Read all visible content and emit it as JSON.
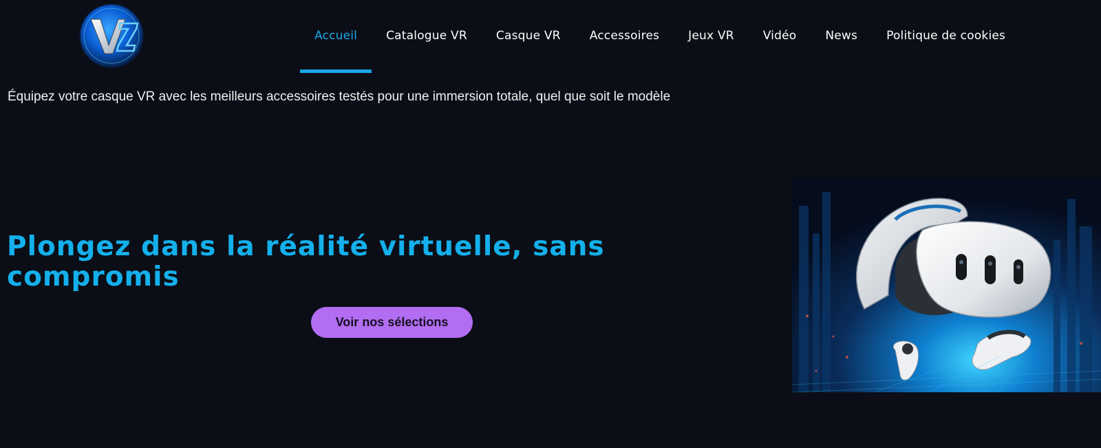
{
  "header": {
    "logo": {
      "icon": "vr-logo-icon",
      "letters": "VZ"
    },
    "nav": [
      {
        "label": "Accueil",
        "active": true
      },
      {
        "label": "Catalogue VR",
        "active": false
      },
      {
        "label": "Casque VR",
        "active": false
      },
      {
        "label": "Accessoires",
        "active": false
      },
      {
        "label": "Jeux VR",
        "active": false
      },
      {
        "label": "Vidéo",
        "active": false
      },
      {
        "label": "News",
        "active": false
      },
      {
        "label": "Politique de cookies",
        "active": false
      }
    ]
  },
  "tagline": "Équipez votre casque VR avec les meilleurs accessoires testés pour une immersion totale, quel que soit le modèle",
  "hero": {
    "title": "Plongez dans la réalité virtuelle, sans compromis",
    "cta_label": "Voir nos sélections",
    "image": "vr-headset-image"
  },
  "colors": {
    "background": "#0b0e16",
    "accent": "#1aa7e8",
    "title": "#14b0ec",
    "cta": "#b26df2"
  }
}
